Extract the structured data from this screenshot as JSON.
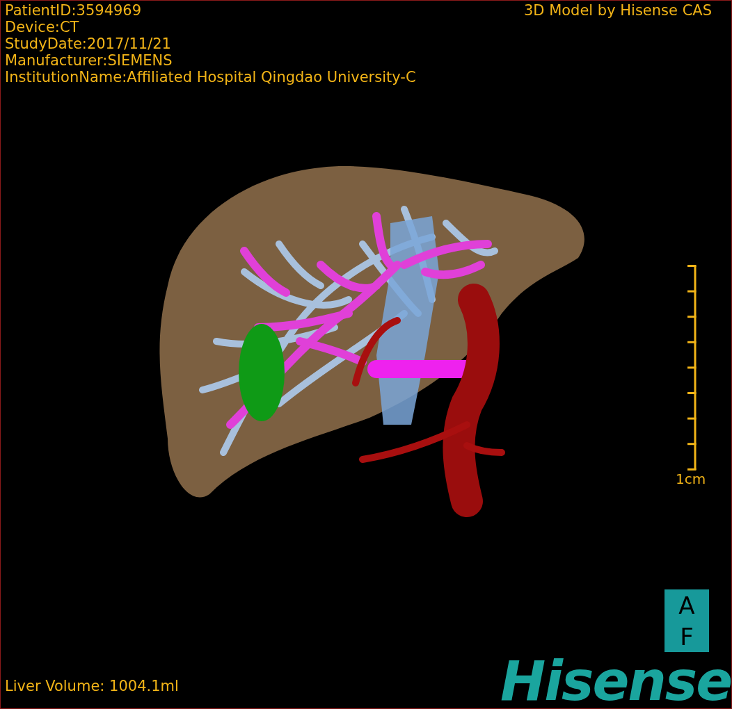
{
  "info_lines": [
    "PatientID:3594969",
    "Device:CT",
    "StudyDate:2017/11/21",
    "Manufacturer:SIEMENS",
    "InstitutionName:Affiliated Hospital Qingdao University-C"
  ],
  "title": "3D Model by Hisense CAS",
  "scale_bar": {
    "label": "1cm"
  },
  "orientation_marker": {
    "top": "A",
    "bottom": "F"
  },
  "logo": "Hisense",
  "volume": "Liver Volume: 1004.1ml"
}
